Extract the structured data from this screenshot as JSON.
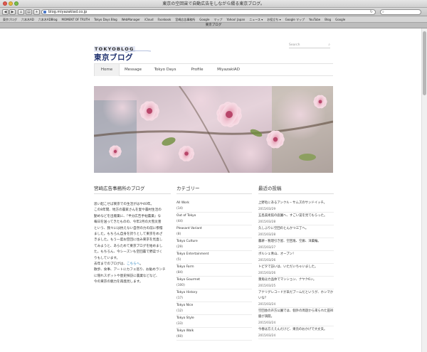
{
  "window": {
    "title": "東京の空回宙で自動広告をしながら綴る東京ブログ。",
    "tab_title": "東京ブログ"
  },
  "toolbar": {
    "url": "blog.miyazakiad.co.jp"
  },
  "bookmarks": [
    "東京ブログ",
    "六本木AD",
    "六本木ADBlog",
    "MOMENT OF TRUTH",
    "Tokyo Days Blog",
    "WebManager",
    "iCloud",
    "Facebook",
    "宮崎広告事務所",
    "Google",
    "マップ",
    "Yahoo! Japan",
    "ニュース ▾",
    "お役立ち ▾",
    "Google マップ",
    "YouTube",
    "Blog",
    "Google"
  ],
  "header": {
    "logo_en": "TOKYOBLOG",
    "logo_jp": "東京ブログ",
    "search_placeholder": "Search"
  },
  "nav": [
    {
      "label": "Home",
      "active": true
    },
    {
      "label": "Message",
      "active": false
    },
    {
      "label": "Tokyo Days",
      "active": false
    },
    {
      "label": "Profile",
      "active": false
    },
    {
      "label": "MiyazakiAD",
      "active": false
    }
  ],
  "about": {
    "title": "宮崎広告事務所のブログ",
    "p1": [
      "思い起こせば東京での生活がはや40年。",
      "この8年間、地方の農家さんを愛や農村生活の",
      "勤めなどを出版業に、『半分広告手帖農業』な",
      "毎日を送ってきたものの、今年2月の大雪災害",
      "という、我々には抗えない自然の力の前に惨憺",
      "ました。もちろん自身を誇りとして東京をめざ",
      "きました。もう一度お空回に住み東京を見直し",
      "てみようと、あらためて東京ブログを始めまし",
      "た。もちろん、今シーズンも空回農で野菜づく",
      "りもしています。"
    ],
    "p2_prefix": "去年までのブログは、",
    "p2_link": "こちらへ",
    "p2_suffix": "。",
    "p3": [
      "散歩、食事、アートにカフェ巡り、お勧めランチ",
      "に隠れスポットや歴史探訪に農業などなど、",
      "今の東京の魅力を再発見します。"
    ]
  },
  "categories": {
    "title": "カテゴリー",
    "items": [
      {
        "name": "All Work",
        "count": "(14)"
      },
      {
        "name": "Out of Tokyo",
        "count": "(44)"
      },
      {
        "name": "Pleasant Variant",
        "count": "(8)"
      },
      {
        "name": "Tokyo Culture",
        "count": "(29)"
      },
      {
        "name": "Tokyo Entertainment",
        "count": "(5)"
      },
      {
        "name": "Tokyo Farm",
        "count": "(84)"
      },
      {
        "name": "Tokyo Gourmet",
        "count": "(100)"
      },
      {
        "name": "Tokyo History",
        "count": "(17)"
      },
      {
        "name": "Tokyo Nice",
        "count": "(12)"
      },
      {
        "name": "Tokyo Style",
        "count": "(33)"
      },
      {
        "name": "Tokyo Walk",
        "count": "(60)"
      }
    ]
  },
  "recent": {
    "title": "最近の投稿",
    "items": [
      {
        "title": "上野毛にあるアンクル・サムズのサンドイッチ。",
        "date": "2015/03/29"
      },
      {
        "title": "五島美術館の庭園へ、すごい菜を見てもらった。",
        "date": "2015/03/28"
      },
      {
        "title": "久しぶりに空回のとんかつ三丁へ。",
        "date": "2015/03/28"
      },
      {
        "title": "農耕・税理引き屋、空回塩、空廊、洋菓輪。",
        "date": "2015/03/27"
      },
      {
        "title": "ボルシェ青山、オープン！",
        "date": "2015/03/26"
      },
      {
        "title": "トピタで訪いは、いただいちゃいました。",
        "date": "2015/03/26"
      },
      {
        "title": "重角ほ力品体でマンション、ナヤク6ン。",
        "date": "2015/03/25"
      },
      {
        "title": "アナリグレコードが未だブームだというが、ホンマか",
        "title2": "いな？",
        "date": "2015/03/24"
      },
      {
        "title": "空回会の声方公園では、個外の周遊から来られた田祥",
        "title2": "脇が満開。",
        "date": "2015/03/24"
      },
      {
        "title": "今春は方ええんだけど、果売のおかげで大丈夫。",
        "date": "2015/03/24"
      }
    ]
  },
  "colors": {
    "logo_blue": "#1d2f6e",
    "link": "#2e86c1",
    "nav_active_bg": "#f1f1f1"
  }
}
